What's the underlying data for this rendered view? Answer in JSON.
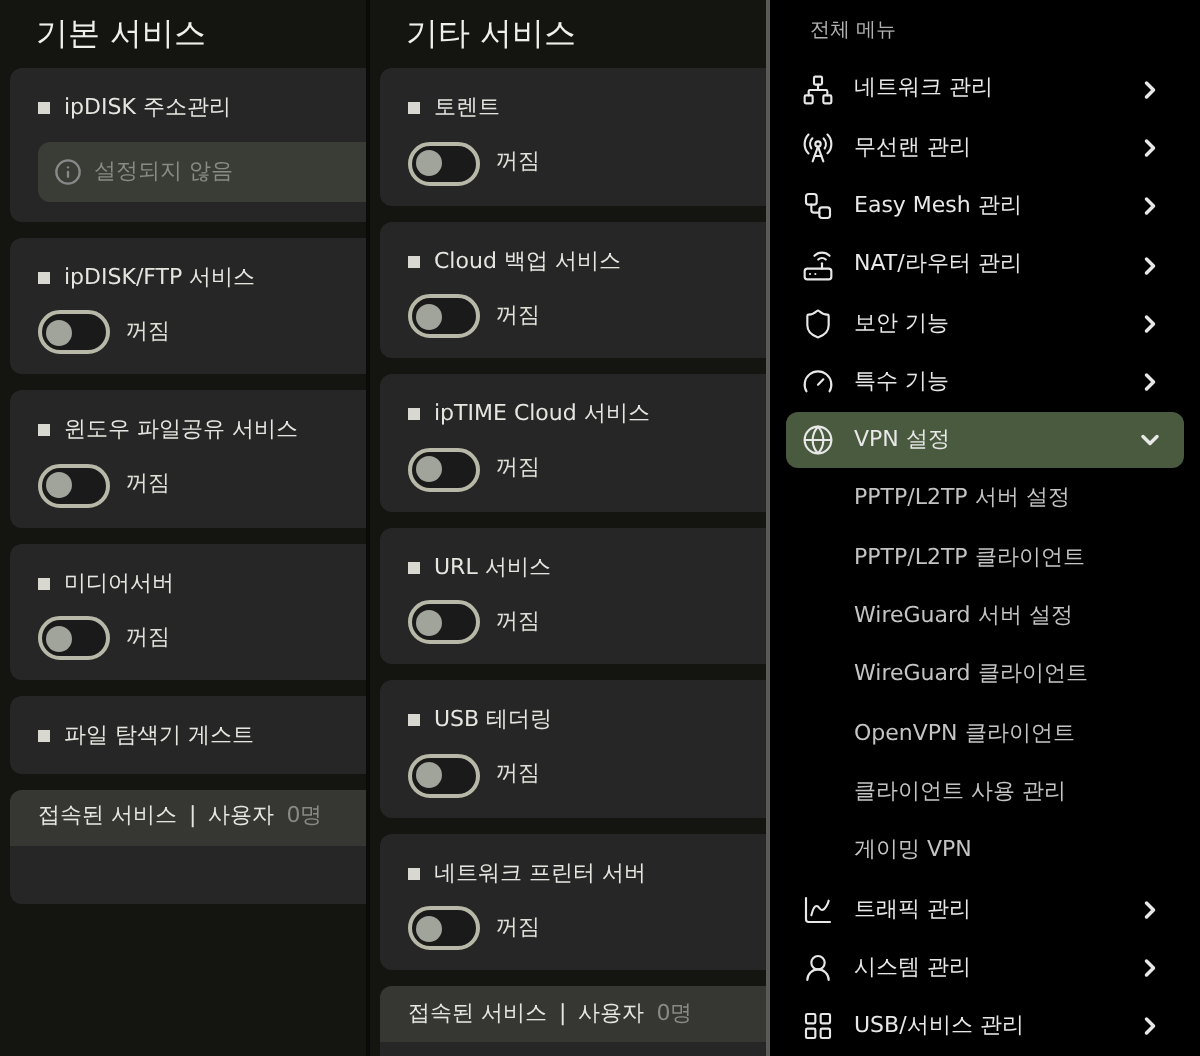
{
  "panels": [
    {
      "title": "기본 서비스",
      "cards": [
        {
          "kind": "field",
          "title": "ipDISK 주소관리",
          "placeholder": "설정되지 않음"
        },
        {
          "kind": "toggle",
          "title": "ipDISK/FTP 서비스",
          "on": false,
          "state_label": "꺼짐"
        },
        {
          "kind": "toggle",
          "title": "윈도우 파일공유 서비스",
          "on": false,
          "state_label": "꺼짐"
        },
        {
          "kind": "toggle",
          "title": "미디어서버",
          "on": false,
          "state_label": "꺼짐"
        },
        {
          "kind": "plain",
          "title": "파일 탐색기 게스트"
        }
      ],
      "footer": {
        "label": "접속된 서비스",
        "separator": "|",
        "user_label": "사용자",
        "user_count": "0명"
      }
    },
    {
      "title": "기타 서비스",
      "cards": [
        {
          "kind": "toggle",
          "title": "토렌트",
          "on": false,
          "state_label": "꺼짐"
        },
        {
          "kind": "toggle",
          "title": "Cloud 백업 서비스",
          "on": false,
          "state_label": "꺼짐"
        },
        {
          "kind": "toggle",
          "title": "ipTIME Cloud 서비스",
          "on": false,
          "state_label": "꺼짐"
        },
        {
          "kind": "toggle",
          "title": "URL 서비스",
          "on": false,
          "state_label": "꺼짐"
        },
        {
          "kind": "toggle",
          "title": "USB 테더링",
          "on": false,
          "state_label": "꺼짐"
        },
        {
          "kind": "toggle",
          "title": "네트워크 프린터 서버",
          "on": false,
          "state_label": "꺼짐"
        }
      ],
      "footer": {
        "label": "접속된 서비스",
        "separator": "|",
        "user_label": "사용자",
        "user_count": "0명"
      }
    }
  ],
  "menu": {
    "title": "전체 메뉴",
    "items": [
      {
        "kind": "menu",
        "label": "네트워크 관리",
        "selected": false,
        "expanded": false
      },
      {
        "kind": "menu",
        "label": "무선랜 관리",
        "selected": false,
        "expanded": false
      },
      {
        "kind": "menu",
        "label": "Easy Mesh 관리",
        "selected": false,
        "expanded": false
      },
      {
        "kind": "menu",
        "label": "NAT/라우터 관리",
        "selected": false,
        "expanded": false
      },
      {
        "kind": "menu",
        "label": "보안 기능",
        "selected": false,
        "expanded": false
      },
      {
        "kind": "menu",
        "label": "특수 기능",
        "selected": false,
        "expanded": false
      },
      {
        "kind": "menu",
        "label": "VPN 설정",
        "selected": true,
        "expanded": true
      },
      {
        "kind": "sub",
        "label": "PPTP/L2TP 서버 설정",
        "selected": false
      },
      {
        "kind": "sub",
        "label": "PPTP/L2TP 클라이언트",
        "selected": false
      },
      {
        "kind": "sub",
        "label": "WireGuard 서버 설정",
        "selected": false
      },
      {
        "kind": "sub",
        "label": "WireGuard 클라이언트",
        "selected": false
      },
      {
        "kind": "sub",
        "label": "OpenVPN 클라이언트",
        "selected": false
      },
      {
        "kind": "sub",
        "label": "클라이언트 사용 관리",
        "selected": false
      },
      {
        "kind": "sub",
        "label": "게이밍 VPN",
        "selected": false
      },
      {
        "kind": "menu",
        "label": "트래픽 관리",
        "selected": false,
        "expanded": false
      },
      {
        "kind": "menu",
        "label": "시스템 관리",
        "selected": false,
        "expanded": false
      },
      {
        "kind": "menu",
        "label": "USB/서비스 관리",
        "selected": false,
        "expanded": false
      }
    ]
  }
}
